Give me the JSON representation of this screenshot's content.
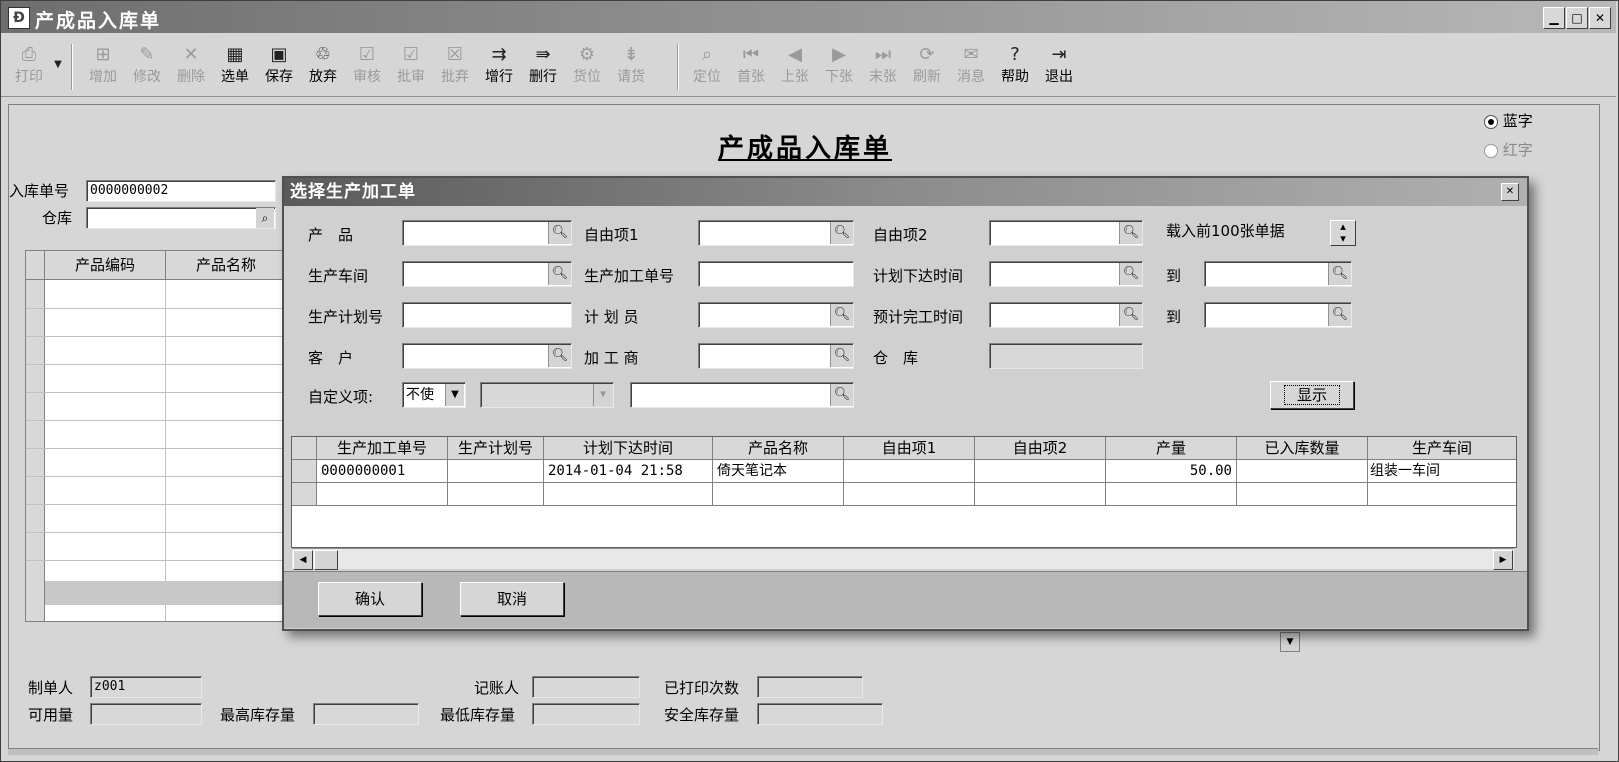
{
  "window": {
    "title": "产成品入库单",
    "app_icon": "document-app-icon",
    "controls": [
      "minimize-icon",
      "maximize-icon",
      "close-icon"
    ]
  },
  "toolbar": {
    "items": [
      {
        "label": "打印",
        "icon": "printer-icon",
        "enabled": false
      },
      {
        "label": "增加",
        "icon": "add-icon",
        "enabled": false
      },
      {
        "label": "修改",
        "icon": "edit-icon",
        "enabled": false
      },
      {
        "label": "删除",
        "icon": "delete-icon",
        "enabled": false
      },
      {
        "label": "选单",
        "icon": "select-order-icon",
        "enabled": true
      },
      {
        "label": "保存",
        "icon": "save-icon",
        "enabled": true
      },
      {
        "label": "放弃",
        "icon": "discard-icon",
        "enabled": true
      },
      {
        "label": "审核",
        "icon": "audit-icon",
        "enabled": false
      },
      {
        "label": "批审",
        "icon": "batch-audit-icon",
        "enabled": false
      },
      {
        "label": "批弃",
        "icon": "batch-discard-icon",
        "enabled": false
      },
      {
        "label": "增行",
        "icon": "add-row-icon",
        "enabled": true
      },
      {
        "label": "删行",
        "icon": "delete-row-icon",
        "enabled": true
      },
      {
        "label": "货位",
        "icon": "location-icon",
        "enabled": false
      },
      {
        "label": "请货",
        "icon": "request-goods-icon",
        "enabled": false
      },
      {
        "label": "定位",
        "icon": "locate-icon",
        "enabled": false
      },
      {
        "label": "首张",
        "icon": "first-icon",
        "enabled": false
      },
      {
        "label": "上张",
        "icon": "prev-icon",
        "enabled": false
      },
      {
        "label": "下张",
        "icon": "next-icon",
        "enabled": false
      },
      {
        "label": "末张",
        "icon": "last-icon",
        "enabled": false
      },
      {
        "label": "刷新",
        "icon": "refresh-icon",
        "enabled": false
      },
      {
        "label": "消息",
        "icon": "message-icon",
        "enabled": false
      },
      {
        "label": "帮助",
        "icon": "help-icon",
        "enabled": true
      },
      {
        "label": "退出",
        "icon": "exit-icon",
        "enabled": true
      }
    ]
  },
  "form": {
    "heading": "产成品入库单",
    "radio_blue": "蓝字",
    "radio_red": "红字",
    "selected_radio": "蓝字",
    "receipt_no_label": "入库单号",
    "receipt_no": "0000000002",
    "warehouse_label": "仓库",
    "warehouse": "",
    "grid_headers": [
      "产品编码",
      "产品名称"
    ],
    "maker_label": "制单人",
    "maker": "z001",
    "bookkeeper_label": "记账人",
    "bookkeeper": "",
    "print_count_label": "已打印次数",
    "print_count": "",
    "available_label": "可用量",
    "available": "",
    "max_stock_label": "最高库存量",
    "max_stock": "",
    "min_stock_label": "最低库存量",
    "min_stock": "",
    "safety_stock_label": "安全库存量",
    "safety_stock": ""
  },
  "dialog": {
    "title": "选择生产加工单",
    "filters": {
      "product_label": "产　品",
      "product": "",
      "free1_label": "自由项1",
      "free1": "",
      "free2_label": "自由项2",
      "free2": "",
      "load_label": "载入前100张单据",
      "workshop_label": "生产车间",
      "workshop": "",
      "order_no_label": "生产加工单号",
      "order_no": "",
      "plan_issue_label": "计划下达时间",
      "plan_issue_from": "",
      "to_label": "到",
      "plan_issue_to": "",
      "plan_no_label": "生产计划号",
      "plan_no": "",
      "planner_label": "计 划 员",
      "planner": "",
      "expected_done_label": "预计完工时间",
      "expected_done_from": "",
      "expected_done_to": "",
      "customer_label": "客　户",
      "customer": "",
      "processor_label": "加 工 商",
      "processor": "",
      "warehouse_label": "仓　库",
      "warehouse": "",
      "custom_label": "自定义项:",
      "custom_select": "不使",
      "custom_field": "",
      "custom_value": "",
      "show_button": "显示"
    },
    "grid": {
      "headers": [
        "生产加工单号",
        "生产计划号",
        "计划下达时间",
        "产品名称",
        "自由项1",
        "自由项2",
        "产量",
        "已入库数量",
        "生产车间"
      ],
      "rows": [
        [
          "0000000001",
          "",
          "2014-01-04 21:58",
          "倚天笔记本",
          "",
          "",
          "50.00",
          "",
          "组装一车间"
        ],
        [
          "",
          "",
          "",
          "",
          "",
          "",
          "",
          "",
          ""
        ]
      ]
    },
    "confirm_button": "确认",
    "cancel_button": "取消"
  }
}
